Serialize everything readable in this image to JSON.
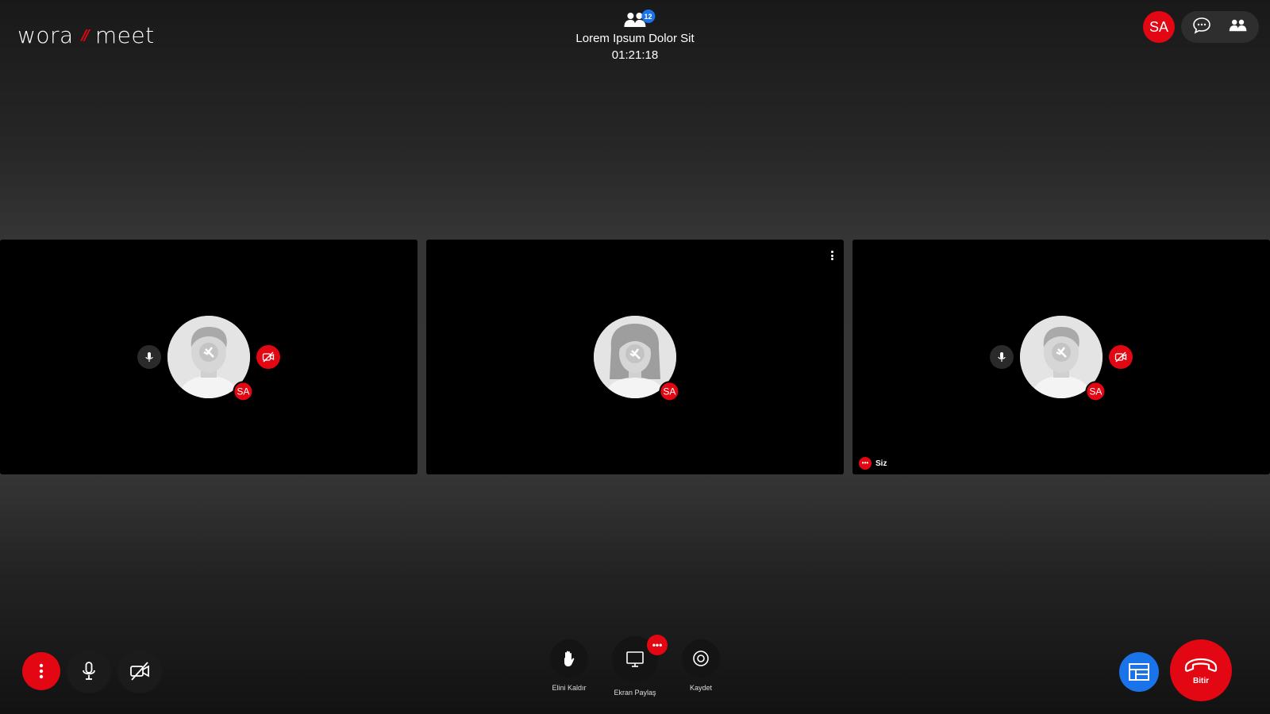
{
  "header": {
    "logo_left": "wora",
    "logo_slash": "//",
    "logo_right": "meet",
    "participant_count": "12",
    "meeting_title": "Lorem Ipsum Dolor Sit",
    "timer": "01:21:18",
    "user_initials": "SA"
  },
  "tiles": [
    {
      "initials": "SA",
      "avatar": "male",
      "mic_icon": "mic-icon",
      "cam_icon": "camera-off-icon"
    },
    {
      "initials": "SA",
      "avatar": "female"
    },
    {
      "initials": "SA",
      "avatar": "male",
      "mic_icon": "mic-icon",
      "cam_icon": "camera-off-icon",
      "self_label": "Siz"
    }
  ],
  "controls": {
    "raise_hand": "Elini Kaldır",
    "share_screen": "Ekran Paylaş",
    "record": "Kaydet",
    "end_call": "Bitir",
    "share_badge": "•••"
  },
  "colors": {
    "accent_red": "#e30613",
    "accent_blue": "#1a73e8"
  }
}
